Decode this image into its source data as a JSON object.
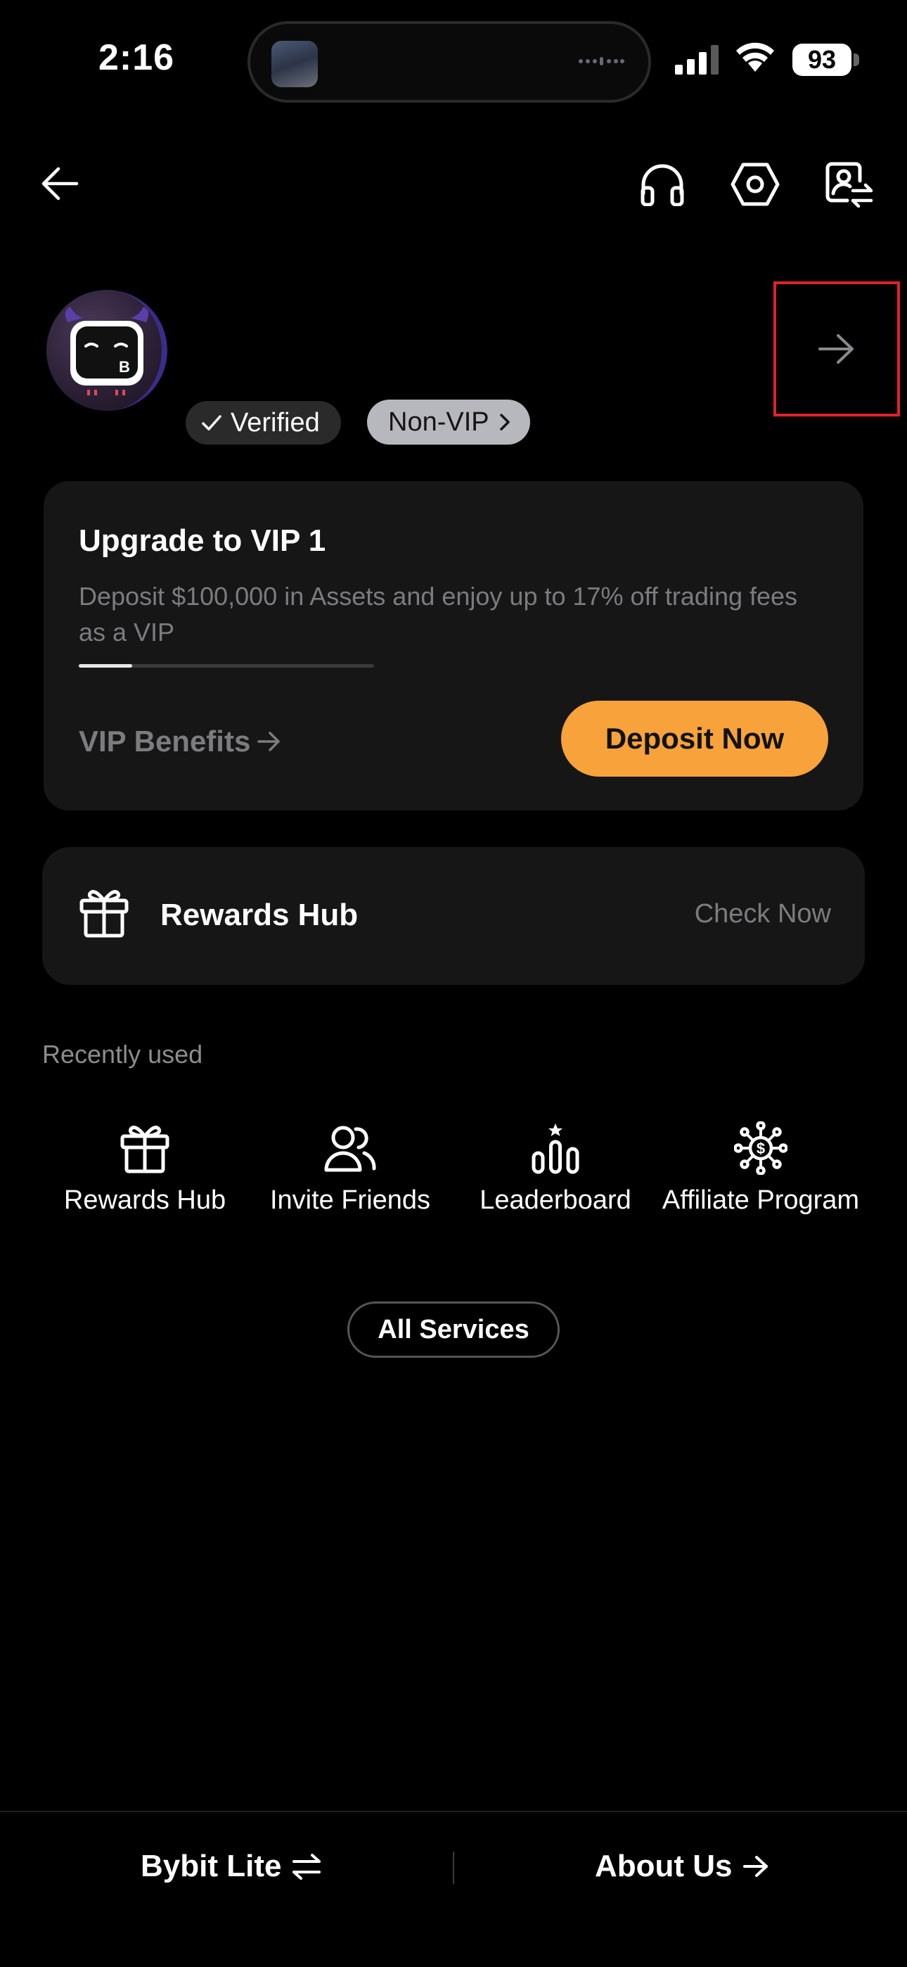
{
  "status_bar": {
    "time": "2:16",
    "battery": "93"
  },
  "nav": {
    "back_icon": "arrow-left-icon",
    "support_icon": "headset-icon",
    "settings_icon": "hexagon-settings-icon",
    "switch_account_icon": "account-switch-icon"
  },
  "profile": {
    "verified_label": "Verified",
    "vip_label": "Non-VIP"
  },
  "vip_card": {
    "title": "Upgrade to VIP 1",
    "description": "Deposit $100,000 in Assets and enjoy up to 17% off trading fees as a VIP",
    "progress": 0.18,
    "benefits_label": "VIP Benefits",
    "deposit_label": "Deposit Now"
  },
  "rewards_card": {
    "title": "Rewards Hub",
    "action_label": "Check Now"
  },
  "recently_used": {
    "heading": "Recently used",
    "items": [
      {
        "label": "Rewards Hub",
        "icon": "gift-icon"
      },
      {
        "label": "Invite Friends",
        "icon": "users-icon"
      },
      {
        "label": "Leaderboard",
        "icon": "leaderboard-icon"
      },
      {
        "label": "Affiliate Program",
        "icon": "affiliate-icon"
      }
    ]
  },
  "all_services_label": "All Services",
  "bottom_bar": {
    "lite_label": "Bybit Lite",
    "about_label": "About Us"
  },
  "colors": {
    "accent": "#F7A23B",
    "background": "#000000",
    "card": "#161616",
    "muted_text": "#7C7C80"
  }
}
